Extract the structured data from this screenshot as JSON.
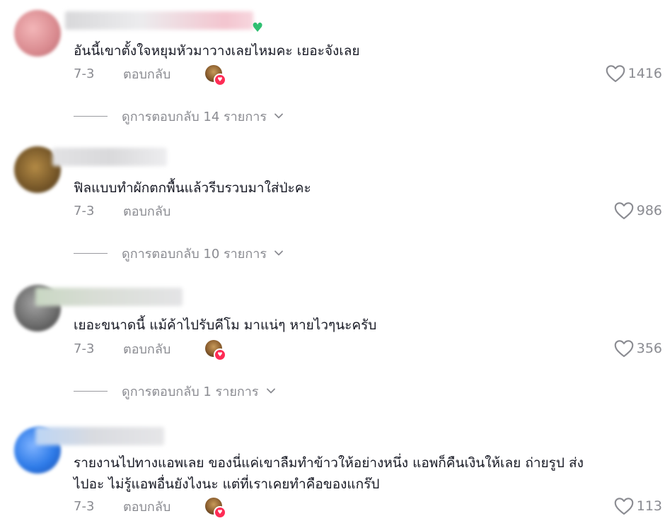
{
  "comments": [
    {
      "text": "อันนี้เขาตั้งใจหยุมหัวมาวางเลยไหมคะ เยอะจังเลย",
      "date": "7-3",
      "reply_label": "ตอบกลับ",
      "likes": "1416",
      "view_replies": "ดูการตอบกลับ 14 รายการ",
      "has_creator_like": true,
      "avatar_color": "#d98a8f",
      "has_name_emoji": true
    },
    {
      "text": "ฟิลแบบทำผักตกพื้นแล้วรีบรวบมาใส่ป่ะคะ",
      "date": "7-3",
      "reply_label": "ตอบกลับ",
      "likes": "986",
      "view_replies": "ดูการตอบกลับ 10 รายการ",
      "has_creator_like": false,
      "avatar_color": "#7a5a2a"
    },
    {
      "text": "เยอะขนาดนี้ แม้ค้าไปรับคีโม มาแน่ๆ หายไวๆนะครับ",
      "date": "7-3",
      "reply_label": "ตอบกลับ",
      "likes": "356",
      "view_replies": "ดูการตอบกลับ 1 รายการ",
      "has_creator_like": true,
      "avatar_color": "#6e6e6e"
    },
    {
      "text": "รายงานไปทางแอพเลย ของนี่แค่เขาลืมทำข้าวให้อย่างหนึ่ง แอพก็คืนเงินให้เลย ถ่ายรูป ส่ง\nไปอะ ไม่รู้แอพอื่นยังไงนะ แต่ที่เราเคยทำคือของแกร๊ป",
      "date": "7-3",
      "reply_label": "ตอบกลับ",
      "likes": "113",
      "has_creator_like": true,
      "avatar_color": "#2e7be8"
    }
  ],
  "colors": {
    "muted": "#8a8b91",
    "text": "#161823",
    "accent": "#fe2c55",
    "heart_emoji": "#2fbf71"
  },
  "icons": {
    "like": "heart-outline-icon",
    "expand": "chevron-down-icon",
    "creator_badge": "creator-liked-heart-icon"
  }
}
